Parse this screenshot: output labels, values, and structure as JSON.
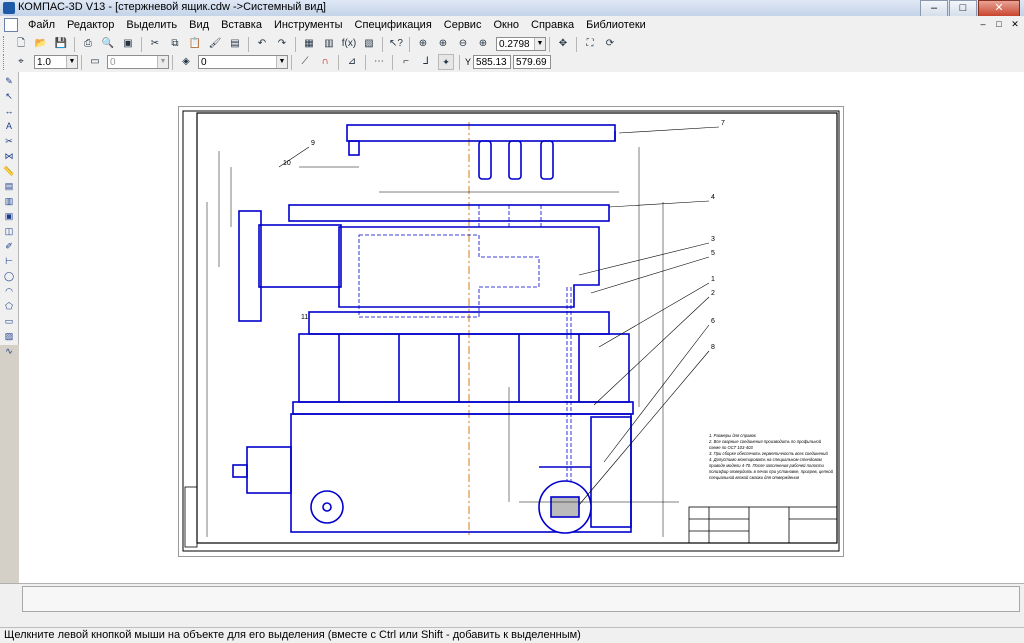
{
  "window": {
    "title": "КОМПАС-3D V13 - [стержневой ящик.cdw ->Системный вид]",
    "min_label": "–",
    "max_label": "□",
    "close_label": "✕"
  },
  "menu": {
    "items": [
      "Файл",
      "Редактор",
      "Выделить",
      "Вид",
      "Вставка",
      "Инструменты",
      "Спецификация",
      "Сервис",
      "Окно",
      "Справка",
      "Библиотеки"
    ],
    "mdi_min": "–",
    "mdi_max": "□",
    "mdi_close": "✕"
  },
  "toolbar": {
    "zoom_value": "0.2798"
  },
  "props_toolbar": {
    "step_value": "1.0",
    "layer_value": "0",
    "style_value": "0",
    "coord_x": "585.13",
    "coord_y": "579.69",
    "coord_label": "Y"
  },
  "drawing": {
    "notes": [
      "1. Размеры для справок",
      "2. Все сварные соединения производить по профильной",
      "схеме по ОСТ 103-403",
      "3. При сборке обеспечить герметичность всех соединений",
      "4. Допустимо монтировать на специальном стендовом",
      "приводе модели 4-70. После заполнения рабочей полости",
      "полиэфир отвердить в печах при установке, прогрев, цепной",
      "специальной вязкой смазки для отверждения"
    ],
    "callouts": [
      "7",
      "4",
      "3",
      "5",
      "1",
      "2",
      "6",
      "8",
      "9",
      "10",
      "11"
    ]
  },
  "status": {
    "message": "Щелкните левой кнопкой мыши на объекте для его выделения (вместе с Ctrl или Shift - добавить к выделенным)"
  },
  "colors": {
    "geometry": "#0000cc",
    "axis": "#d97b1a",
    "frame": "#000000"
  }
}
